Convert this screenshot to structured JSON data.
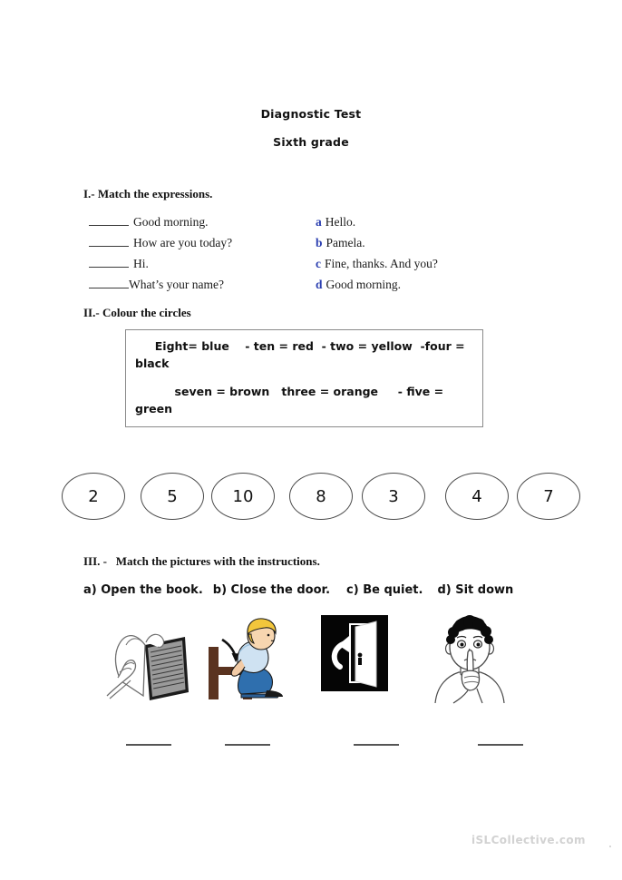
{
  "document": {
    "title": "Diagnostic Test",
    "subtitle": "Sixth grade",
    "watermark": "iSLCollective.com"
  },
  "sections": {
    "one": {
      "heading": "I.- Match the expressions.",
      "prompts": [
        "Good morning.",
        "How are you today?",
        "Hi.",
        "What’s your name?"
      ],
      "options": [
        {
          "letter": "a",
          "text": "Hello."
        },
        {
          "letter": "b",
          "text": "Pamela."
        },
        {
          "letter": "c",
          "text": "Fine, thanks. And you?"
        },
        {
          "letter": "d",
          "text": "Good morning."
        }
      ],
      "letter_color": "#2b3fb0"
    },
    "two": {
      "heading": "II.- Colour the circles",
      "key_line_1": "     Eight= blue    - ten = red  - two = yellow  -four = black",
      "key_line_2": "          seven = brown   three = orange     - five = green",
      "pairs": [
        {
          "number": "Eight",
          "colour": "blue"
        },
        {
          "number": "ten",
          "colour": "red"
        },
        {
          "number": "two",
          "colour": "yellow"
        },
        {
          "number": "four",
          "colour": "black"
        },
        {
          "number": "seven",
          "colour": "brown"
        },
        {
          "number": "three",
          "colour": "orange"
        },
        {
          "number": "five",
          "colour": "green"
        }
      ],
      "circles": [
        "2",
        "5",
        "10",
        "8",
        "3",
        "4",
        "7"
      ]
    },
    "three": {
      "heading": "III. -   Match the pictures with the instructions.",
      "instructions": [
        "a) Open the book.",
        "b) Close the door.",
        "c) Be quiet.",
        "d) Sit down"
      ],
      "pictures": [
        {
          "name": "open-book",
          "alt": "open book with hand"
        },
        {
          "name": "sit-down",
          "alt": "boy sitting down on a chair"
        },
        {
          "name": "close-door",
          "alt": "door with closing arrow"
        },
        {
          "name": "be-quiet",
          "alt": "boy with finger on lips"
        }
      ],
      "answer_blanks": [
        "",
        "",
        "",
        ""
      ]
    }
  }
}
